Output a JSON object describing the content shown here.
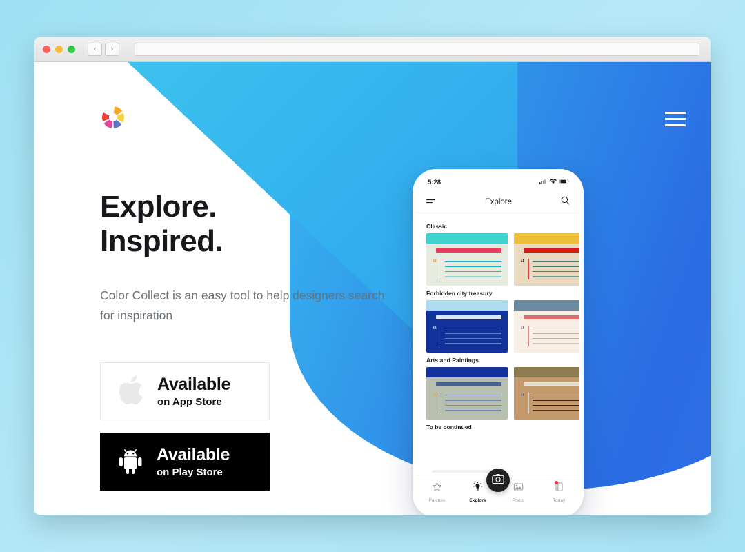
{
  "browser": {
    "back_label": "‹",
    "forward_label": "›",
    "url_value": "",
    "url_placeholder": ""
  },
  "site": {
    "logo_name": "color-collect-aperture-logo",
    "menu_icon": "hamburger-menu-icon",
    "headline_line1": "Explore.",
    "headline_line2": "Inspired.",
    "subtext": "Color Collect is an easy tool to help designers search for inspiration",
    "colors": {
      "cyan": "#35b6ee",
      "blue": "#2a6ce4",
      "page_bg": "#a8e4f5",
      "headline": "#17181c",
      "subtext": "#6d7278"
    }
  },
  "stores": [
    {
      "icon": "apple-icon",
      "big_label": "Available",
      "small_label": "on App Store",
      "theme": "light"
    },
    {
      "icon": "android-icon",
      "big_label": "Available",
      "small_label": "on Play Store",
      "theme": "dark"
    }
  ],
  "phone": {
    "status": {
      "time": "5:28",
      "signal_icon": "cellular-signal-icon",
      "wifi_icon": "wifi-icon",
      "battery_icon": "battery-icon"
    },
    "appbar": {
      "menu_icon": "filter-lines-icon",
      "title": "Explore",
      "search_icon": "search-icon"
    },
    "groups": [
      {
        "title": "Classic",
        "cards": [
          {
            "name": "classic-teal-card",
            "head": "#3fd2cf",
            "body": "#e6ece0",
            "title_bar": "#ef3a5d",
            "quote": "#f9a825",
            "vbar": "#ef6f78",
            "lines": [
              "#1eb4d4",
              "#1eb4d4",
              "#1eb4d4",
              "#8fd4d8"
            ]
          },
          {
            "name": "classic-yellow-card",
            "head": "#efbf3a",
            "body": "#e8d9bf",
            "title_bar": "#d61a16",
            "quote": "#2b2b2b",
            "vbar": "#e03c3c",
            "lines": [
              "#3f8079",
              "#3f8079",
              "#3f8079",
              "#6f9c95"
            ]
          }
        ]
      },
      {
        "title": "Forbidden city treasury",
        "cards": [
          {
            "name": "forbidden-navy-card",
            "head": "#aedcef",
            "body": "#10329a",
            "title_bar": "#dbe7f5",
            "quote": "#c7d4e8",
            "vbar": "#b9c8e0",
            "lines": [
              "#5f7fc4",
              "#5f7fc4",
              "#5f7fc4",
              "#5f7fc4"
            ]
          },
          {
            "name": "forbidden-steel-card",
            "head": "#6b8ba3",
            "body": "#f7eee6",
            "title_bar": "#da6f6d",
            "quote": "#6b6b6b",
            "vbar": "#e08a84",
            "lines": [
              "#c2b09b",
              "#c2b09b",
              "#c2b09b",
              "#d6c9b8"
            ]
          }
        ]
      },
      {
        "title": "Arts and Paintings",
        "cards": [
          {
            "name": "arts-blue-card",
            "head": "#17319b",
            "body": "#b9bfae",
            "title_bar": "#48618f",
            "quote": "#e8b431",
            "vbar": "#5f7391",
            "lines": [
              "#6f8cb8",
              "#6f8cb8",
              "#6f8cb8",
              "#6f8cb8"
            ]
          },
          {
            "name": "arts-tan-card",
            "head": "#8f7c4e",
            "body": "#c49a6c",
            "title_bar": "#e5e2d3",
            "quote": "#5c6b82",
            "vbar": "#d9d2c2",
            "lines": [
              "#6b4423",
              "#3a2410",
              "#3a2410",
              "#5a3518"
            ]
          }
        ]
      },
      {
        "title": "To be continued",
        "cards": []
      }
    ],
    "tabs": [
      {
        "name": "tab-palettes",
        "icon": "star-icon",
        "label": "Palettes",
        "active": false,
        "badge": false
      },
      {
        "name": "tab-explore",
        "icon": "lightbulb-icon",
        "label": "Explore",
        "active": true,
        "badge": false
      },
      {
        "name": "tab-photo",
        "icon": "photo-icon",
        "label": "Photo",
        "active": false,
        "badge": false
      },
      {
        "name": "tab-today",
        "icon": "today-icon",
        "label": "Today",
        "active": false,
        "badge": true
      }
    ],
    "fab": {
      "icon": "camera-icon"
    }
  }
}
